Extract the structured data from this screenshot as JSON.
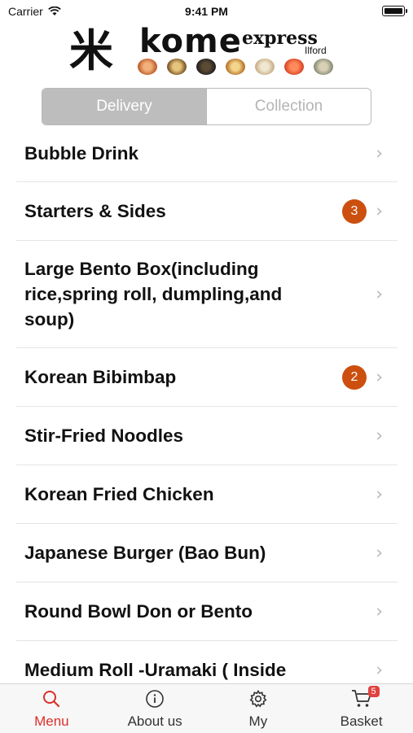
{
  "status_bar": {
    "carrier": "Carrier",
    "time": "9:41 PM"
  },
  "logo": {
    "kanji": "米",
    "brand": "kome",
    "express": "express",
    "place": "Ilford"
  },
  "segment": {
    "delivery": "Delivery",
    "collection": "Collection"
  },
  "categories": [
    {
      "label": "Bubble Drink",
      "badge": ""
    },
    {
      "label": "Starters & Sides",
      "badge": "3"
    },
    {
      "label": "Large Bento Box(including rice,spring roll, dumpling,and soup)",
      "badge": ""
    },
    {
      "label": "Korean Bibimbap",
      "badge": "2"
    },
    {
      "label": "Stir-Fried Noodles",
      "badge": ""
    },
    {
      "label": "Korean Fried Chicken",
      "badge": ""
    },
    {
      "label": "Japanese Burger (Bao Bun)",
      "badge": ""
    },
    {
      "label": "Round Bowl Don or Bento",
      "badge": ""
    },
    {
      "label": "Medium Roll -Uramaki ( Inside",
      "badge": ""
    }
  ],
  "tabs": {
    "menu": "Menu",
    "about": "About us",
    "my": "My",
    "basket": "Basket",
    "basket_count": "5"
  },
  "colors": {
    "accent": "#d9302c",
    "badge": "#cc4f0f",
    "segment_active": "#bdbdbd"
  }
}
